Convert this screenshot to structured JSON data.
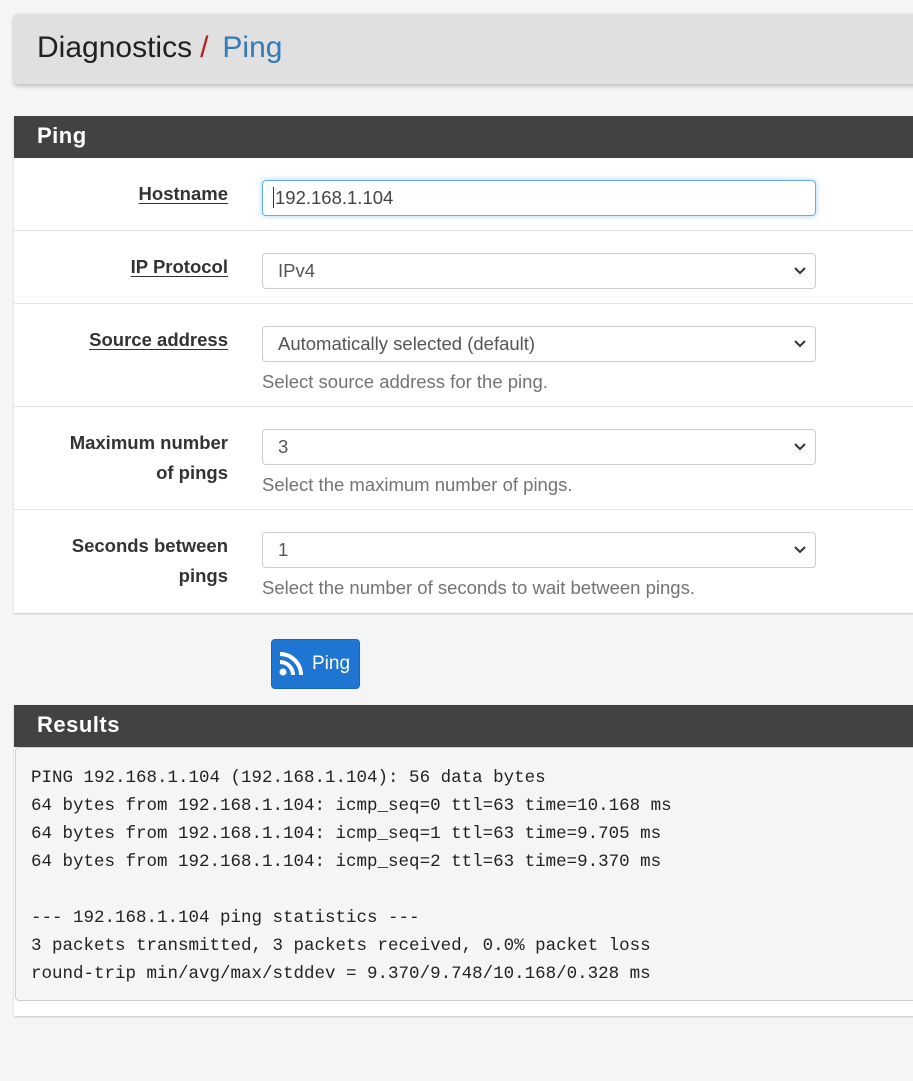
{
  "breadcrumb": {
    "parent": "Diagnostics",
    "separator": "/",
    "current": "Ping"
  },
  "form": {
    "title": "Ping",
    "hostname": {
      "label": "Hostname",
      "value": "192.168.1.104"
    },
    "ip_protocol": {
      "label": "IP Protocol",
      "value": "IPv4"
    },
    "source_address": {
      "label": "Source address",
      "value": "Automatically selected (default)",
      "help": "Select source address for the ping."
    },
    "max_pings": {
      "label_line1": "Maximum number",
      "label_line2": "of pings",
      "value": "3",
      "help": "Select the maximum number of pings."
    },
    "seconds_between": {
      "label_line1": "Seconds between",
      "label_line2": "pings",
      "value": "1",
      "help": "Select the number of seconds to wait between pings."
    }
  },
  "ping_button": {
    "label": "Ping",
    "icon": "rss-icon",
    "color": "#1e76d2"
  },
  "results": {
    "title": "Results",
    "output": "PING 192.168.1.104 (192.168.1.104): 56 data bytes\n64 bytes from 192.168.1.104: icmp_seq=0 ttl=63 time=10.168 ms\n64 bytes from 192.168.1.104: icmp_seq=1 ttl=63 time=9.705 ms\n64 bytes from 192.168.1.104: icmp_seq=2 ttl=63 time=9.370 ms\n\n--- 192.168.1.104 ping statistics ---\n3 packets transmitted, 3 packets received, 0.0% packet loss\nround-trip min/avg/max/stddev = 9.370/9.748/10.168/0.328 ms"
  }
}
